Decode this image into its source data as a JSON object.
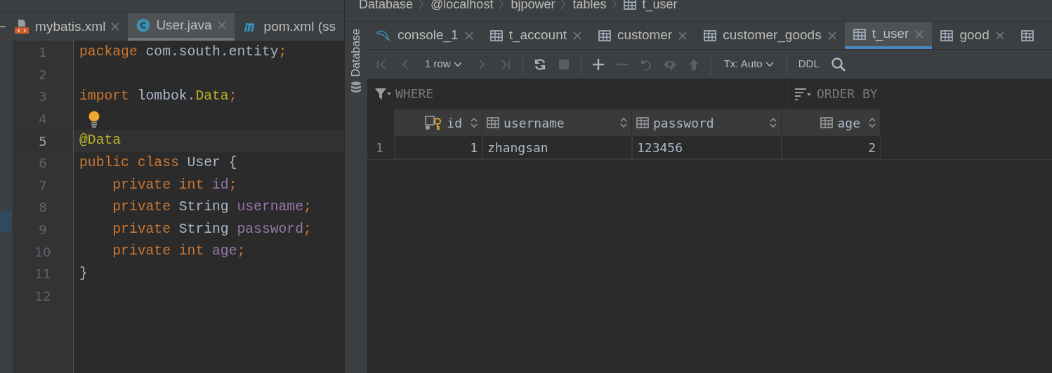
{
  "editor": {
    "tabs": [
      {
        "label": "mybatis.xml",
        "kind": "xml",
        "selected": false,
        "closable": true
      },
      {
        "label": "User.java",
        "kind": "class",
        "selected": true,
        "closable": true
      },
      {
        "label": "pom.xml (ss",
        "kind": "maven",
        "selected": false,
        "closable": false
      }
    ],
    "lines": [
      {
        "number": "1",
        "current": false,
        "tokens": [
          {
            "kind": "keyword",
            "text": "package "
          },
          {
            "kind": "plain",
            "text": "com.south.entity"
          },
          {
            "kind": "keyword",
            "text": ";"
          }
        ]
      },
      {
        "number": "2",
        "current": false
      },
      {
        "number": "3",
        "current": false,
        "tokens": [
          {
            "kind": "keyword",
            "text": "import "
          },
          {
            "kind": "plain",
            "text": "lombok."
          },
          {
            "kind": "annotation",
            "text": "Data"
          },
          {
            "kind": "keyword",
            "text": ";"
          }
        ]
      },
      {
        "number": "4",
        "current": false,
        "bulb": true
      },
      {
        "number": "5",
        "current": true,
        "tokens": [
          {
            "kind": "annotation",
            "text": "@Data"
          }
        ]
      },
      {
        "number": "6",
        "current": false,
        "tokens": [
          {
            "kind": "keyword",
            "text": "public class "
          },
          {
            "kind": "plain",
            "text": "User {"
          }
        ]
      },
      {
        "number": "7",
        "current": false,
        "tokens": [
          {
            "kind": "keyword",
            "text": "    private int "
          },
          {
            "kind": "field",
            "text": "id"
          },
          {
            "kind": "keyword",
            "text": ";"
          }
        ]
      },
      {
        "number": "8",
        "current": false,
        "tokens": [
          {
            "kind": "keyword",
            "text": "    private "
          },
          {
            "kind": "plain",
            "text": "String "
          },
          {
            "kind": "field",
            "text": "username"
          },
          {
            "kind": "keyword",
            "text": ";"
          }
        ]
      },
      {
        "number": "9",
        "current": false,
        "tokens": [
          {
            "kind": "keyword",
            "text": "    private "
          },
          {
            "kind": "plain",
            "text": "String "
          },
          {
            "kind": "field",
            "text": "password"
          },
          {
            "kind": "keyword",
            "text": ";"
          }
        ]
      },
      {
        "number": "10",
        "current": false,
        "tokens": [
          {
            "kind": "keyword",
            "text": "    private int "
          },
          {
            "kind": "field",
            "text": "age"
          },
          {
            "kind": "keyword",
            "text": ";"
          }
        ]
      },
      {
        "number": "11",
        "current": false,
        "tokens": [
          {
            "kind": "plain",
            "text": "}"
          }
        ]
      },
      {
        "number": "12",
        "current": false
      }
    ]
  },
  "database": {
    "breadcrumb": [
      {
        "label": "Database",
        "icon": false
      },
      {
        "label": "@localhost",
        "icon": false
      },
      {
        "label": "bjpower",
        "icon": false
      },
      {
        "label": "tables",
        "icon": false
      },
      {
        "label": "t_user",
        "icon": true
      }
    ],
    "side_label": "Database",
    "tabs": [
      {
        "label": "console_1",
        "kind": "console",
        "selected": false
      },
      {
        "label": "t_account",
        "kind": "table",
        "selected": false
      },
      {
        "label": "customer",
        "kind": "table",
        "selected": false
      },
      {
        "label": "customer_goods",
        "kind": "table",
        "selected": false
      },
      {
        "label": "t_user",
        "kind": "table",
        "selected": true
      },
      {
        "label": "good",
        "kind": "table",
        "selected": false
      }
    ],
    "toolbar": [
      {
        "kind": "first",
        "disabled": true
      },
      {
        "kind": "prev",
        "disabled": true
      },
      {
        "kind": "dropdown",
        "text": "1 row"
      },
      {
        "kind": "next",
        "disabled": true
      },
      {
        "kind": "last",
        "disabled": true
      },
      {
        "kind": "sep"
      },
      {
        "kind": "reload",
        "disabled": false
      },
      {
        "kind": "stop",
        "disabled": true
      },
      {
        "kind": "sep"
      },
      {
        "kind": "add",
        "disabled": false
      },
      {
        "kind": "remove",
        "disabled": true
      },
      {
        "kind": "revert",
        "disabled": true
      },
      {
        "kind": "preview",
        "disabled": true
      },
      {
        "kind": "submit",
        "disabled": true
      },
      {
        "kind": "sep"
      },
      {
        "kind": "dropdown",
        "text": "Tx: Auto"
      },
      {
        "kind": "sep"
      },
      {
        "kind": "text",
        "text": "DDL"
      },
      {
        "kind": "search",
        "disabled": false
      }
    ],
    "where_placeholder": "WHERE",
    "order_placeholder": "ORDER BY",
    "table": {
      "columns": [
        {
          "label": "id",
          "key": true,
          "kind": "number"
        },
        {
          "label": "username",
          "key": false,
          "kind": "text"
        },
        {
          "label": "password",
          "key": false,
          "kind": "text"
        },
        {
          "label": "age",
          "key": false,
          "kind": "number"
        }
      ],
      "rows": [
        {
          "number": "1",
          "cells": [
            "1",
            "zhangsan",
            "123456",
            "2"
          ]
        }
      ]
    }
  }
}
